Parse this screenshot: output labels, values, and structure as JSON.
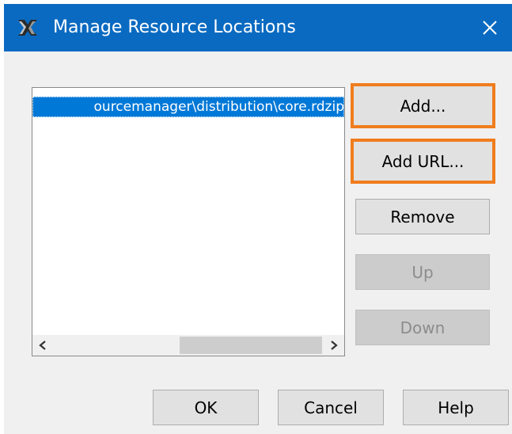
{
  "window": {
    "title": "Manage Resource Locations",
    "close_glyph": "✕"
  },
  "resource_list": {
    "items": [
      "...\\resourcemanager\\distribution\\core.rdzip"
    ],
    "visible_text": "ourcemanager\\distribution\\core.rdzip",
    "scroll_left_glyph": "‹",
    "scroll_right_glyph": "›"
  },
  "side_buttons": {
    "add": "Add...",
    "add_url": "Add URL...",
    "remove": "Remove",
    "up": "Up",
    "down": "Down"
  },
  "footer_buttons": {
    "ok": "OK",
    "cancel": "Cancel",
    "help": "Help"
  },
  "icons": {
    "app": "magicdraw-app-icon",
    "close": "close-icon"
  },
  "colors": {
    "title_bar": "#0a6ac1",
    "selection": "#0078d7",
    "highlight_border": "#f07d1e",
    "dialog_background": "#f0f0f0"
  }
}
